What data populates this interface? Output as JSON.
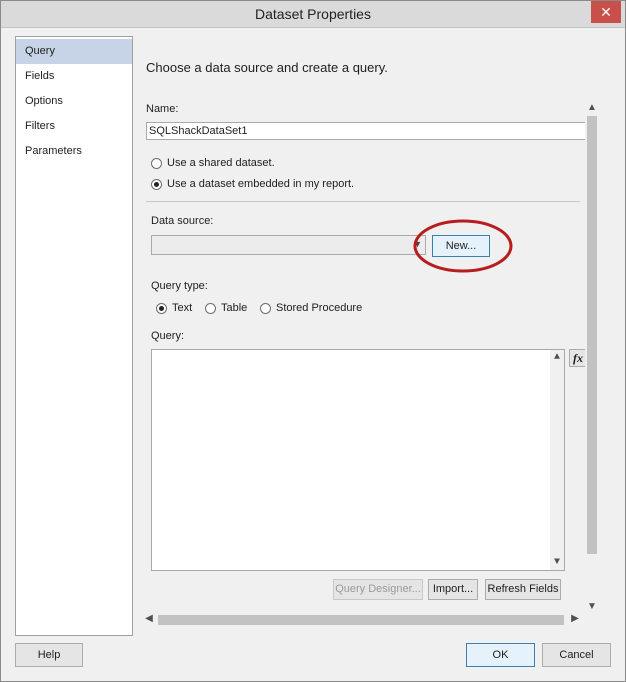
{
  "window": {
    "title": "Dataset Properties",
    "close_glyph": "✕"
  },
  "nav": {
    "items": [
      {
        "label": "Query"
      },
      {
        "label": "Fields"
      },
      {
        "label": "Options"
      },
      {
        "label": "Filters"
      },
      {
        "label": "Parameters"
      }
    ]
  },
  "query_page": {
    "heading": "Choose a data source and create a query.",
    "name_label": "Name:",
    "name_value": "SQLShackDataSet1",
    "radio_shared": "Use a shared dataset.",
    "radio_embedded": "Use a dataset embedded in my report.",
    "datasource_label": "Data source:",
    "datasource_value": "",
    "new_button": "New...",
    "query_type_label": "Query type:",
    "query_types": [
      "Text",
      "Table",
      "Stored Procedure"
    ],
    "query_label": "Query:",
    "query_value": "",
    "function_glyph": "fx",
    "query_designer_button": "Query Designer...",
    "import_button": "Import...",
    "refresh_button": "Refresh Fields"
  },
  "footer": {
    "help": "Help",
    "ok": "OK",
    "cancel": "Cancel"
  },
  "colors": {
    "highlight_circle": "#b81c1c",
    "selected_nav": "#c7d3e6",
    "focus_border": "#3c7fb1"
  }
}
